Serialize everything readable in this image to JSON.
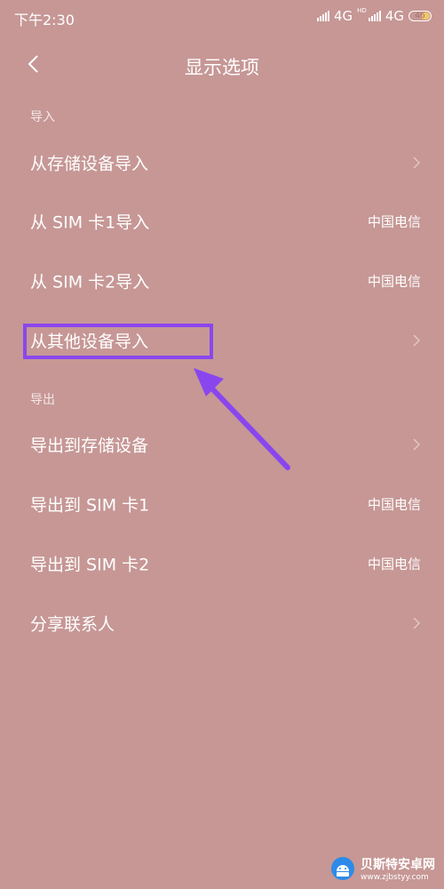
{
  "status_bar": {
    "time": "下午2:30",
    "network1": "4G",
    "hd": "HD",
    "network2": "4G",
    "battery": "46"
  },
  "header": {
    "back_icon": "chevron-left-icon",
    "title": "显示选项"
  },
  "sections": {
    "import": {
      "label": "导入",
      "items": [
        {
          "label": "从存储设备导入",
          "icon": "chevron-right-icon"
        },
        {
          "label": "从 SIM 卡1导入",
          "value": "中国电信"
        },
        {
          "label": "从 SIM 卡2导入",
          "value": "中国电信"
        },
        {
          "label": "从其他设备导入",
          "icon": "chevron-right-icon"
        }
      ]
    },
    "export": {
      "label": "导出",
      "items": [
        {
          "label": "导出到存储设备",
          "icon": "chevron-right-icon"
        },
        {
          "label": "导出到 SIM 卡1",
          "value": "中国电信"
        },
        {
          "label": "导出到 SIM 卡2",
          "value": "中国电信"
        },
        {
          "label": "分享联系人",
          "icon": "chevron-right-icon"
        }
      ]
    }
  },
  "annotation": {
    "highlight_color": "#8a46ee"
  },
  "watermark": {
    "title": "贝斯特安卓网",
    "url": "www.zjbstyy.com"
  },
  "colors": {
    "background": "#c69795",
    "text": "#ffffff"
  }
}
